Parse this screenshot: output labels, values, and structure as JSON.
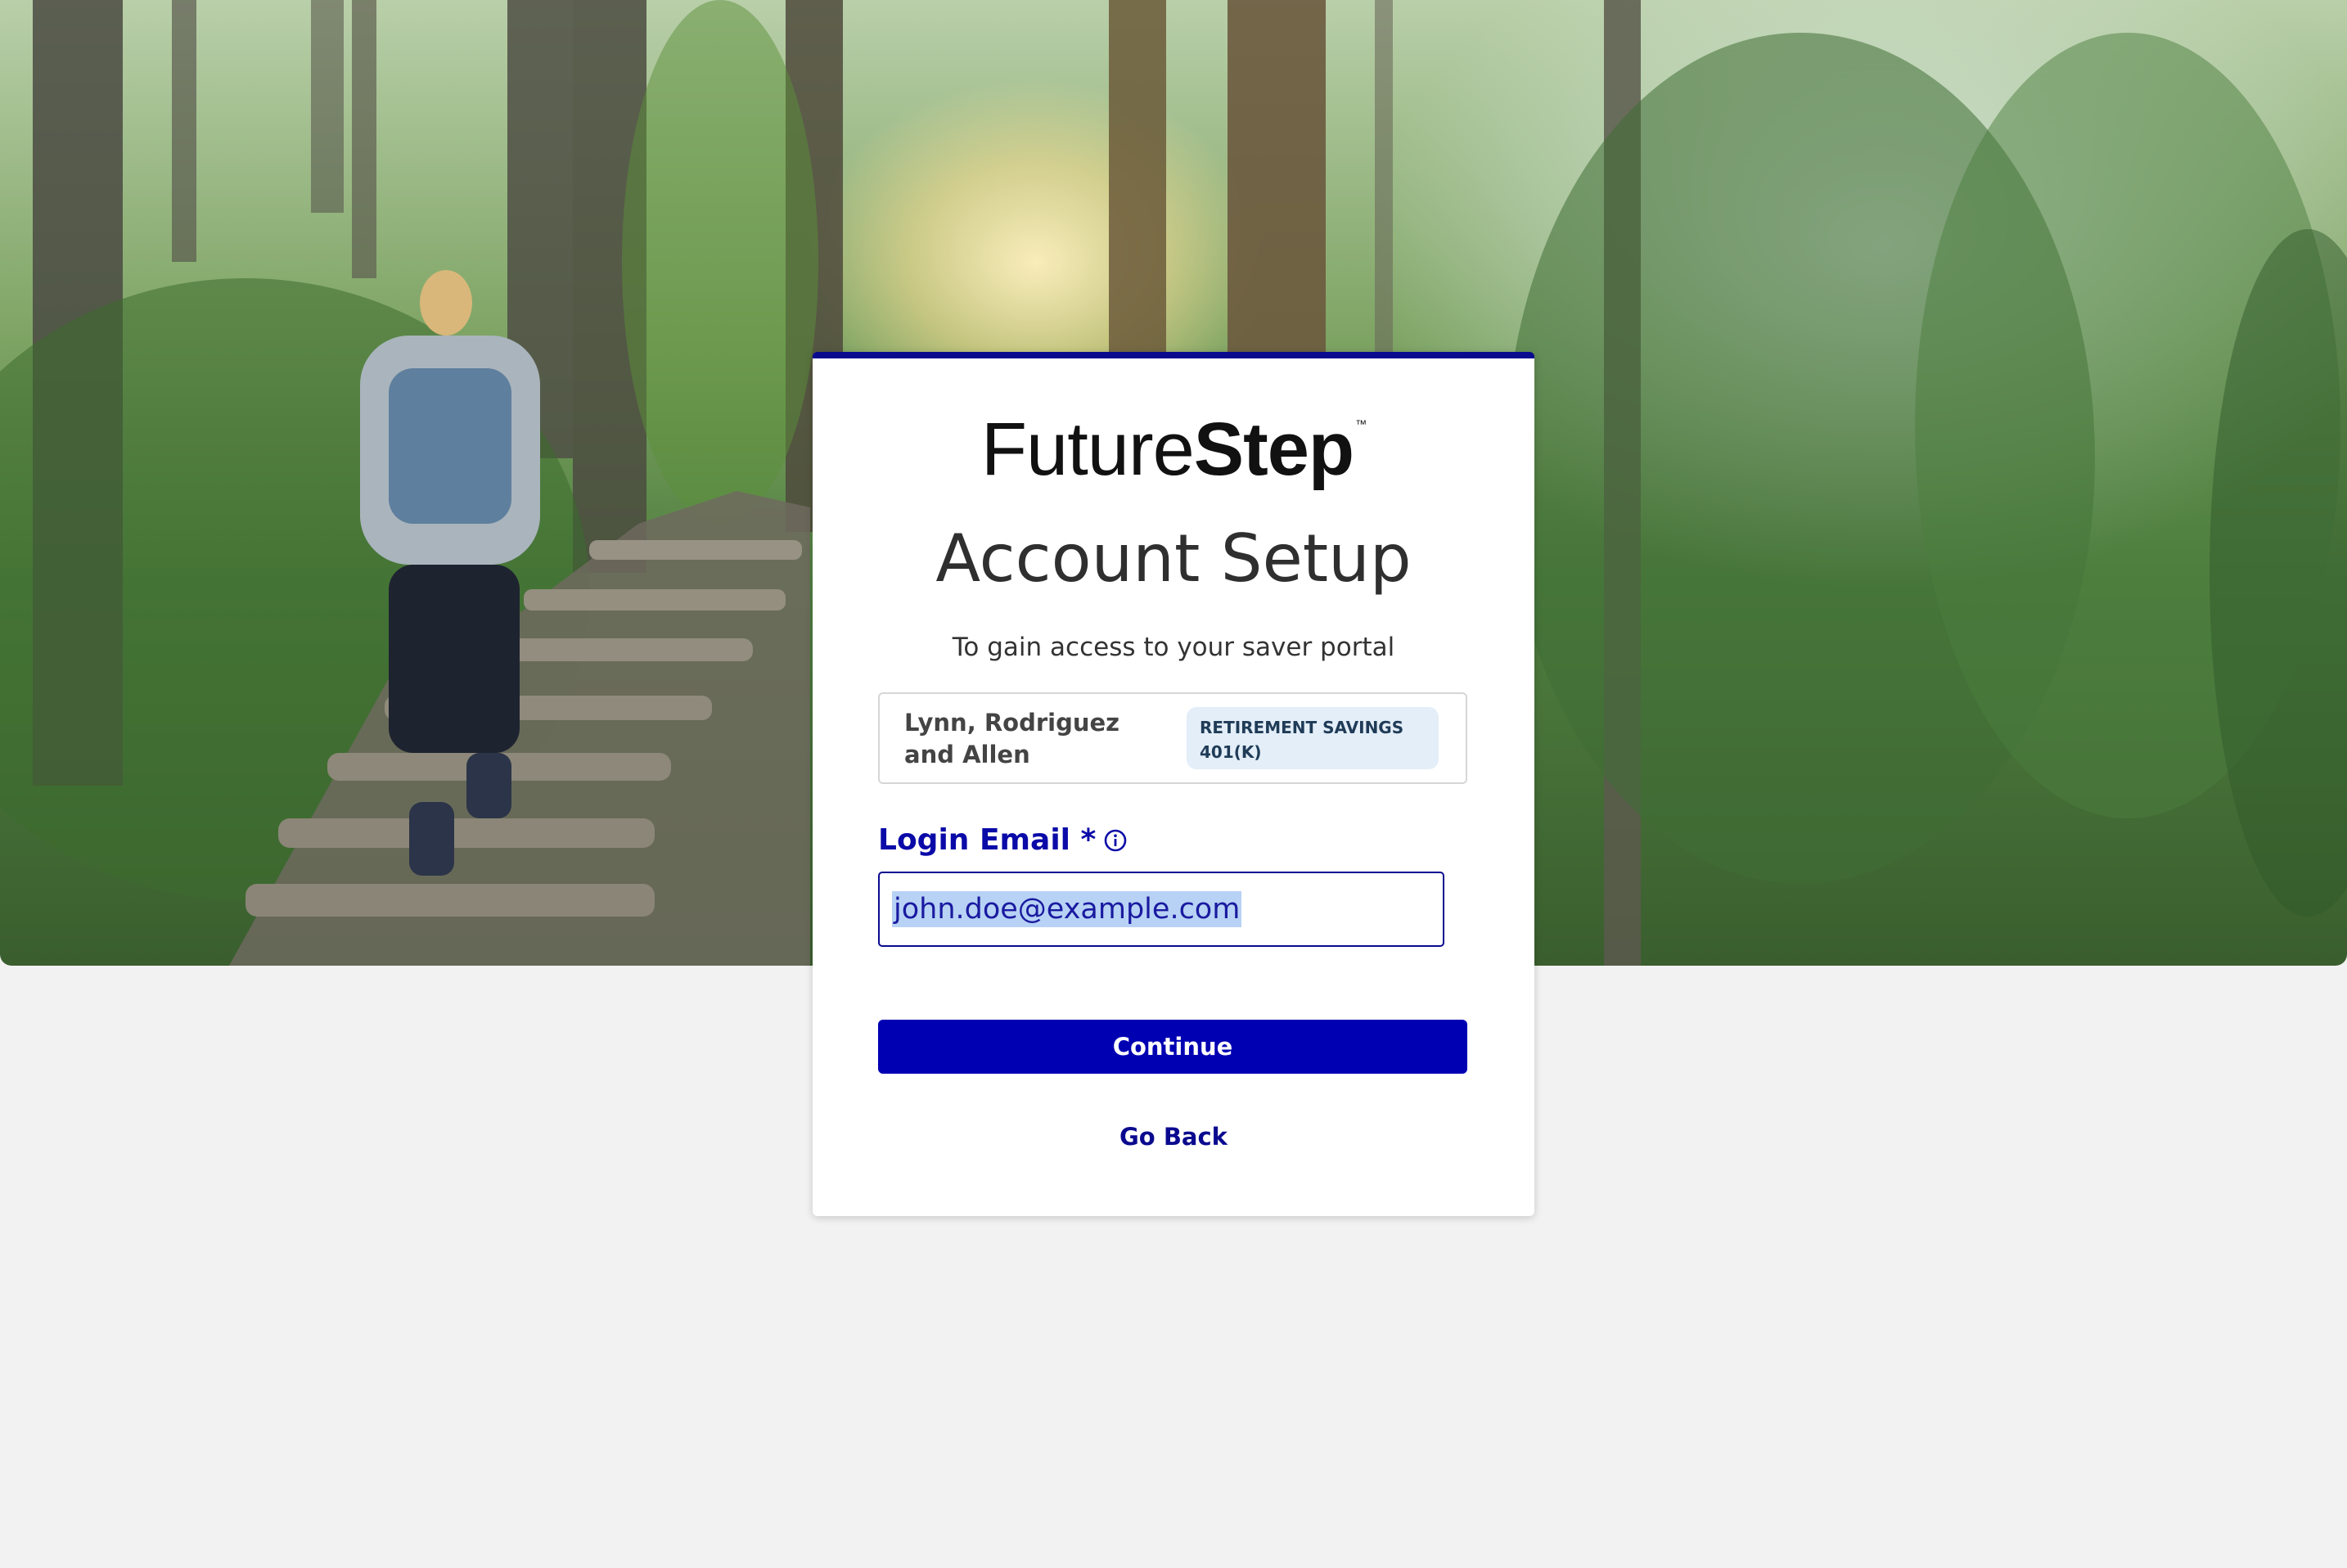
{
  "brand": {
    "logo_light": "Future",
    "logo_bold": "Step",
    "logo_tm": "™"
  },
  "page": {
    "title": "Account Setup",
    "subtitle": "To gain access to your saver portal"
  },
  "employer": {
    "name": "Lynn, Rodriguez and Allen",
    "plan_line1": "RETIREMENT SAVINGS",
    "plan_line2": "401(K)"
  },
  "form": {
    "email_label": "Login Email *",
    "email_value": "john.doe@example.com",
    "info_icon": "info-circle-icon"
  },
  "actions": {
    "continue_label": "Continue",
    "go_back_label": "Go Back"
  },
  "colors": {
    "accent": "#0000b3",
    "card_border_top": "#0a0a8f",
    "badge_bg": "#e3eef8",
    "page_bg": "#f2f2f2"
  }
}
